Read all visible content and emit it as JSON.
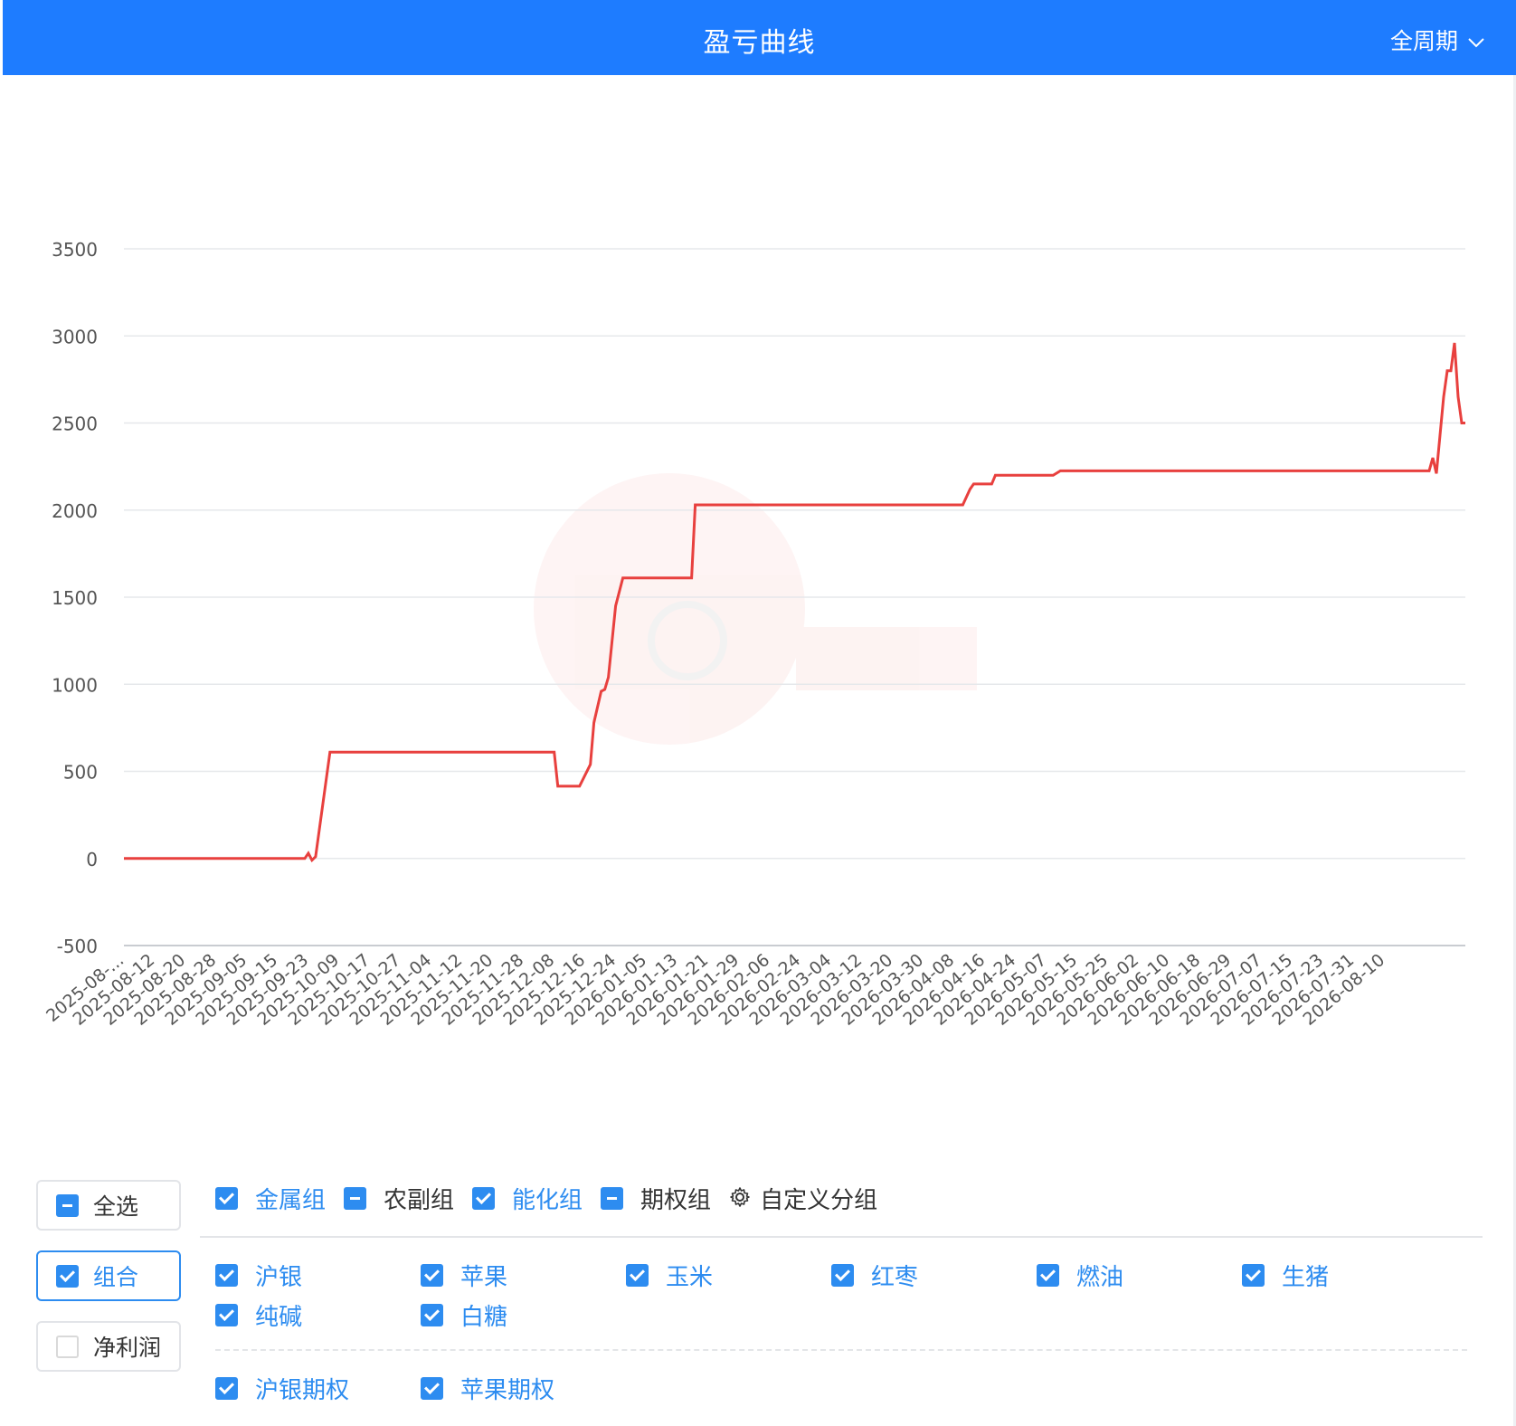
{
  "header": {
    "title": "盈亏曲线",
    "period": "全周期",
    "bg_color": "#1e7cff"
  },
  "chart_data": {
    "type": "line",
    "title": "",
    "xlabel": "",
    "ylabel": "",
    "ylim": [
      -500,
      3500
    ],
    "y_ticks": [
      -500,
      0,
      500,
      1000,
      1500,
      2000,
      2500,
      3000,
      3500
    ],
    "grid": true,
    "x_tick_labels": [
      "2025-08-...",
      "2025-08-12",
      "2025-08-20",
      "2025-08-28",
      "2025-09-05",
      "2025-09-15",
      "2025-09-23",
      "2025-10-09",
      "2025-10-17",
      "2025-10-27",
      "2025-11-04",
      "2025-11-12",
      "2025-11-20",
      "2025-11-28",
      "2025-12-08",
      "2025-12-16",
      "2025-12-24",
      "2026-01-05",
      "2026-01-13",
      "2026-01-21",
      "2026-01-29",
      "2026-02-06",
      "2026-02-24",
      "2026-03-04",
      "2026-03-12",
      "2026-03-20",
      "2026-03-30",
      "2026-04-08",
      "2026-04-16",
      "2026-04-24",
      "2026-05-07",
      "2026-05-15",
      "2026-05-25",
      "2026-06-02",
      "2026-06-10",
      "2026-06-18",
      "2026-06-29",
      "2026-07-07",
      "2026-07-15",
      "2026-07-23",
      "2026-07-31",
      "2026-08-10"
    ],
    "color": "#e8403e",
    "series": [
      {
        "points": [
          [
            "2025-08-04",
            0
          ],
          [
            "2025-09-23",
            0
          ],
          [
            "2025-09-24",
            30
          ],
          [
            "2025-09-25",
            -10
          ],
          [
            "2025-09-26",
            10
          ],
          [
            "2025-09-30",
            610
          ],
          [
            "2025-12-01",
            610
          ],
          [
            "2025-12-02",
            415
          ],
          [
            "2025-12-08",
            415
          ],
          [
            "2025-12-11",
            540
          ],
          [
            "2025-12-12",
            780
          ],
          [
            "2025-12-14",
            960
          ],
          [
            "2025-12-15",
            970
          ],
          [
            "2025-12-16",
            1040
          ],
          [
            "2025-12-18",
            1450
          ],
          [
            "2025-12-20",
            1610
          ],
          [
            "2026-01-08",
            1610
          ],
          [
            "2026-01-09",
            2030
          ],
          [
            "2026-03-24",
            2030
          ],
          [
            "2026-03-26",
            2120
          ],
          [
            "2026-03-27",
            2150
          ],
          [
            "2026-04-01",
            2150
          ],
          [
            "2026-04-02",
            2200
          ],
          [
            "2026-04-18",
            2200
          ],
          [
            "2026-04-20",
            2225
          ],
          [
            "2026-07-31",
            2225
          ],
          [
            "2026-08-01",
            2300
          ],
          [
            "2026-08-02",
            2210
          ],
          [
            "2026-08-04",
            2650
          ],
          [
            "2026-08-05",
            2800
          ],
          [
            "2026-08-06",
            2800
          ],
          [
            "2026-08-07",
            2960
          ],
          [
            "2026-08-08",
            2650
          ],
          [
            "2026-08-09",
            2500
          ],
          [
            "2026-08-10",
            2500
          ]
        ]
      }
    ]
  },
  "side": {
    "select_all": "全选",
    "combo": "组合",
    "net_profit": "净利润"
  },
  "groups": [
    {
      "label": "金属组",
      "state": "checked"
    },
    {
      "label": "农副组",
      "state": "partial"
    },
    {
      "label": "能化组",
      "state": "checked"
    },
    {
      "label": "期权组",
      "state": "partial"
    }
  ],
  "custom_group": "自定义分组",
  "items_row1": [
    "沪银",
    "苹果",
    "玉米",
    "红枣",
    "燃油",
    "生猪"
  ],
  "items_row2": [
    "纯碱",
    "白糖"
  ],
  "options": [
    "沪银期权",
    "苹果期权"
  ],
  "accent_color": "#2d8cf0"
}
